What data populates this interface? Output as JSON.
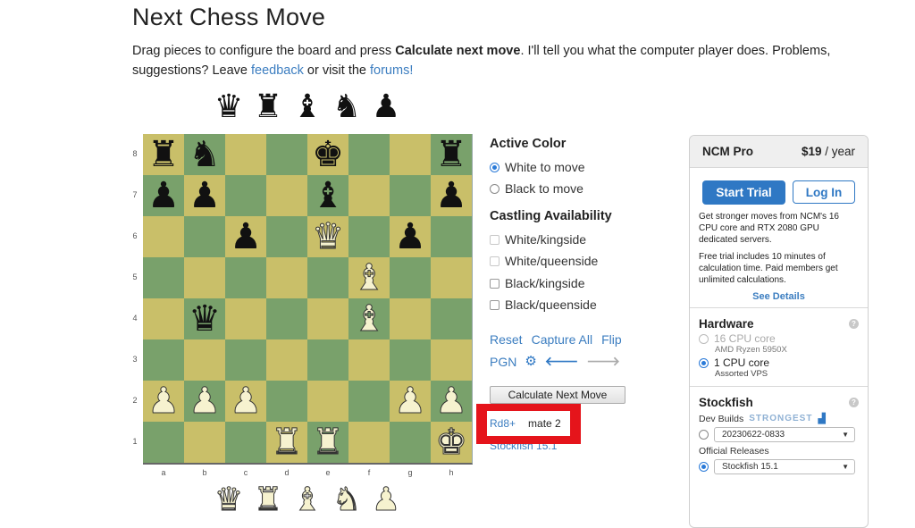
{
  "page": {
    "title": "Next Chess Move",
    "intro_before": "Drag pieces to configure the board and press ",
    "intro_bold": "Calculate next move",
    "intro_mid": ". I'll tell you what the computer player does. Problems, suggestions? Leave ",
    "feedback_link": "feedback",
    "intro_mid2": " or visit the ",
    "forums_link": "forums!"
  },
  "spare_black": [
    {
      "piece": "queen",
      "glyph": "♛"
    },
    {
      "piece": "rook",
      "glyph": "♜"
    },
    {
      "piece": "bishop",
      "glyph": "♝"
    },
    {
      "piece": "knight",
      "glyph": "♞"
    },
    {
      "piece": "pawn",
      "glyph": "♟"
    }
  ],
  "spare_white": [
    {
      "piece": "queen",
      "glyph": "♛"
    },
    {
      "piece": "rook",
      "glyph": "♜"
    },
    {
      "piece": "bishop",
      "glyph": "♝"
    },
    {
      "piece": "knight",
      "glyph": "♞"
    },
    {
      "piece": "pawn",
      "glyph": "♟"
    }
  ],
  "board": {
    "ranks": [
      "8",
      "7",
      "6",
      "5",
      "4",
      "3",
      "2",
      "1"
    ],
    "files": [
      "a",
      "b",
      "c",
      "d",
      "e",
      "f",
      "g",
      "h"
    ],
    "position": [
      [
        "bR",
        "bN",
        "",
        "",
        "bK",
        "",
        "",
        "bR"
      ],
      [
        "bP",
        "bP",
        "",
        "",
        "bB",
        "",
        "",
        "bP"
      ],
      [
        "",
        "",
        "bP",
        "",
        "wQ",
        "",
        "bP",
        ""
      ],
      [
        "",
        "",
        "",
        "",
        "",
        "wB",
        "",
        ""
      ],
      [
        "",
        "bQ",
        "",
        "",
        "",
        "wB",
        "",
        ""
      ],
      [
        "",
        "",
        "",
        "",
        "",
        "",
        "",
        ""
      ],
      [
        "wP",
        "wP",
        "wP",
        "",
        "",
        "",
        "wP",
        "wP"
      ],
      [
        "",
        "",
        "",
        "wR",
        "wR",
        "",
        "",
        "wK"
      ]
    ],
    "glyphs": {
      "K": "♚",
      "Q": "♛",
      "R": "♜",
      "B": "♝",
      "N": "♞",
      "P": "♟"
    },
    "colors": {
      "light": "#c9bf69",
      "dark": "#79a16b"
    }
  },
  "controls": {
    "active_color_label": "Active Color",
    "white_to_move": "White to move",
    "black_to_move": "Black to move",
    "active_color_selected": "white",
    "castling_label": "Castling Availability",
    "castling": [
      {
        "label": "White/kingside",
        "checked": false
      },
      {
        "label": "White/queenside",
        "checked": false
      },
      {
        "label": "Black/kingside",
        "checked": false
      },
      {
        "label": "Black/queenside",
        "checked": false
      }
    ],
    "reset": "Reset",
    "capture_all": "Capture All",
    "flip": "Flip",
    "pgn": "PGN",
    "calculate": "Calculate Next Move",
    "result_move": "Rd8+",
    "result_eval": "mate 2",
    "engine_label": "Stockfish 15.1"
  },
  "pro_panel": {
    "title": "NCM Pro",
    "price": "$19",
    "period": " / year",
    "start_trial": "Start Trial",
    "log_in": "Log In",
    "desc1": "Get stronger moves from NCM's 16 CPU core and RTX 2080 GPU dedicated servers.",
    "desc2": "Free trial includes 10 minutes of calculation time. Paid members get unlimited calculations.",
    "see_details": "See Details",
    "hardware": {
      "title": "Hardware",
      "options": [
        {
          "label": "16 CPU core",
          "sub": "AMD Ryzen 5950X",
          "selected": false,
          "enabled": false
        },
        {
          "label": "1 CPU core",
          "sub": "Assorted VPS",
          "selected": true,
          "enabled": true
        }
      ]
    },
    "stockfish": {
      "title": "Stockfish",
      "dev_builds_label": "Dev Builds",
      "strongest_badge": "STRONGEST",
      "dev_build_value": "20230622-0833",
      "official_label": "Official Releases",
      "official_value": "Stockfish 15.1",
      "selected": "official"
    }
  },
  "accent_colors": {
    "link": "#3b7dc0",
    "primary": "#2f78c4",
    "highlight": "#e5141b"
  }
}
